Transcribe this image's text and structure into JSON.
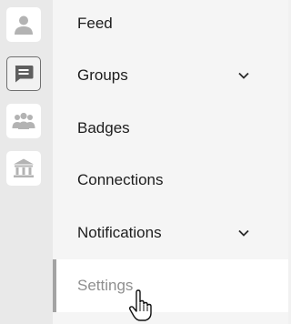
{
  "rail": {
    "items": [
      {
        "icon": "person-icon",
        "active": false
      },
      {
        "icon": "chat-icon",
        "active": true
      },
      {
        "icon": "people-group-icon",
        "active": false
      },
      {
        "icon": "bank-icon",
        "active": false
      }
    ]
  },
  "nav": {
    "items": [
      {
        "label": "Feed",
        "expandable": false
      },
      {
        "label": "Groups",
        "expandable": true
      },
      {
        "label": "Badges",
        "expandable": false
      },
      {
        "label": "Connections",
        "expandable": false
      },
      {
        "label": "Notifications",
        "expandable": true
      },
      {
        "label": "Settings",
        "expandable": false,
        "selected": true
      }
    ]
  },
  "colors": {
    "rail_bg": "#e9e9e9",
    "nav_bg": "#f5f5f5",
    "icon_gray": "#b3b3b3",
    "active_icon": "#5f5f5f",
    "selected_bar": "#a3a3a3",
    "selected_text": "#8f8f8f",
    "text": "#1d1d1d"
  },
  "cursor": {
    "icon": "hand-pointer-icon"
  }
}
